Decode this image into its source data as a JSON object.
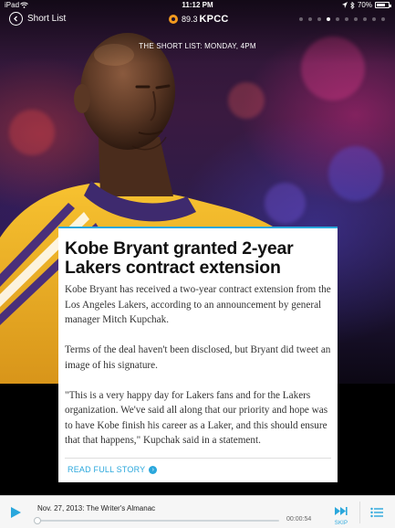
{
  "status_bar": {
    "carrier": "iPad",
    "time": "11:12 PM",
    "battery": "70%"
  },
  "nav": {
    "back_label": "Short List",
    "logo_freq": "89.3",
    "logo_call": "KPCC",
    "pages_total": 10,
    "page_active": 3
  },
  "subtitle": "THE SHORT LIST: MONDAY, 4PM",
  "article": {
    "title": "Kobe Bryant granted 2-year Lakers contract extension",
    "paragraphs": [
      "Kobe Bryant has received a two-year contract extension from the Los Angeles Lakers, according to an announcement by general manager Mitch Kupchak.",
      "Terms of the deal haven't been disclosed, but Bryant did tweet an image of his signature.",
      "\"This is a very happy day for Lakers fans and for the Lakers organization. We've said all along that our priority and hope was to have Kobe finish his career as a Laker, and this should ensure that that happens,\" Kupchak said in a statement."
    ],
    "read_more": "READ FULL STORY"
  },
  "player": {
    "episode": "Nov. 27, 2013: The Writer's Almanac",
    "time": "00:00:54",
    "progress": 0.0,
    "skip_label": "SKIP"
  },
  "colors": {
    "accent": "#2aa7dc",
    "logo_orange": "#f39a1e",
    "jersey_gold": "#f2b51b"
  },
  "icons": {
    "back": "chevron-left-icon",
    "play": "play-icon",
    "skip": "skip-forward-icon",
    "list": "list-icon",
    "wifi": "wifi-icon",
    "bluetooth": "bluetooth-icon",
    "battery": "battery-icon",
    "location": "location-arrow-icon"
  }
}
